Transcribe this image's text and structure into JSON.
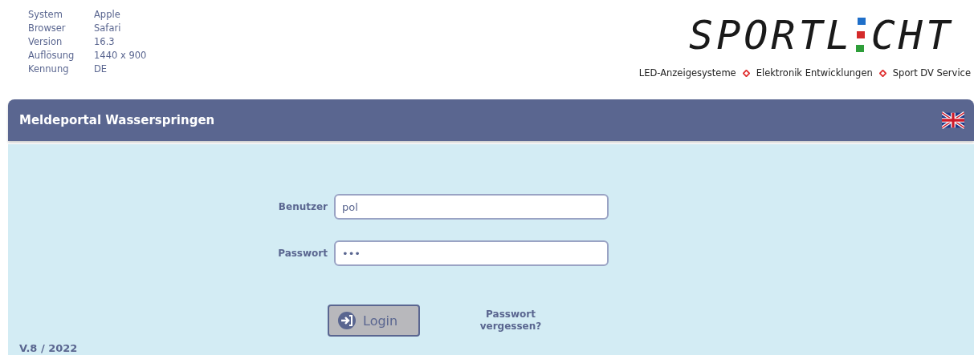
{
  "system_info": [
    {
      "label": "System",
      "value": "Apple"
    },
    {
      "label": "Browser",
      "value": "Safari"
    },
    {
      "label": "Version",
      "value": "16.3"
    },
    {
      "label": "Auflösung",
      "value": "1440 x 900"
    },
    {
      "label": "Kennung",
      "value": "DE"
    }
  ],
  "logo": {
    "left": "SPORTL",
    "right": "CHT"
  },
  "tagline": [
    "LED-Anzeigesysteme",
    "Elektronik Entwicklungen",
    "Sport DV Service"
  ],
  "header": {
    "title": "Meldeportal Wasserspringen"
  },
  "form": {
    "fields": [
      {
        "label": "Benutzer",
        "value": "pol"
      },
      {
        "label": "Passwort",
        "value": "•••"
      }
    ],
    "login_button": "Login",
    "forgot_link": "Passwort vergessen?"
  },
  "version": "V.8 / 2022"
}
